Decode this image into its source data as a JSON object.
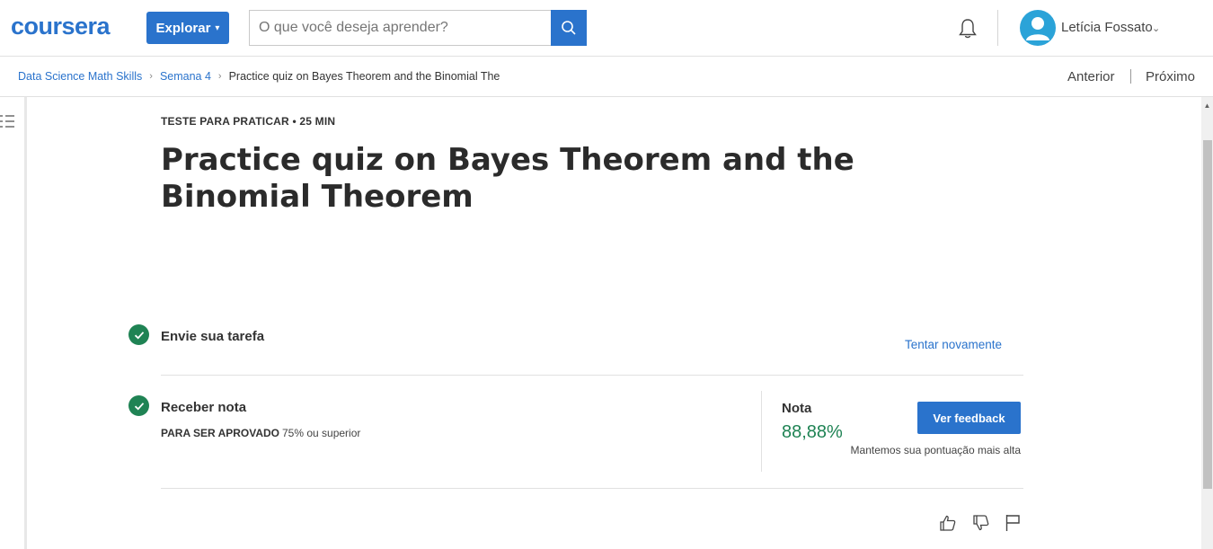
{
  "header": {
    "logo": "coursera",
    "explore_label": "Explorar",
    "search_placeholder": "O que você deseja aprender?",
    "user_name": "Letícia Fossato"
  },
  "breadcrumb": {
    "items": [
      "Data Science Math Skills",
      "Semana 4"
    ],
    "current": "Practice quiz on Bayes Theorem and the Binomial The"
  },
  "nav": {
    "prev": "Anterior",
    "next": "Próximo"
  },
  "quiz": {
    "eyebrow": "TESTE PARA PRATICAR • 25 MIN",
    "title": "Practice quiz on Bayes Theorem and the Binomial Theorem"
  },
  "steps": {
    "submit": {
      "title": "Envie sua tarefa",
      "action": "Tentar novamente"
    },
    "grade": {
      "title": "Receber nota",
      "pass_label": "PARA SER APROVADO",
      "pass_value": "75% ou superior",
      "grade_label": "Nota",
      "grade_value": "88,88%",
      "feedback_button": "Ver feedback",
      "note": "Mantemos sua pontuação mais alta"
    }
  },
  "colors": {
    "accent": "#2a73cc",
    "success": "#1f8354"
  },
  "icons": [
    "search-icon",
    "bell-icon",
    "user-avatar-icon",
    "menu-list-icon",
    "check-icon",
    "thumbs-up-icon",
    "thumbs-down-icon",
    "flag-icon"
  ]
}
